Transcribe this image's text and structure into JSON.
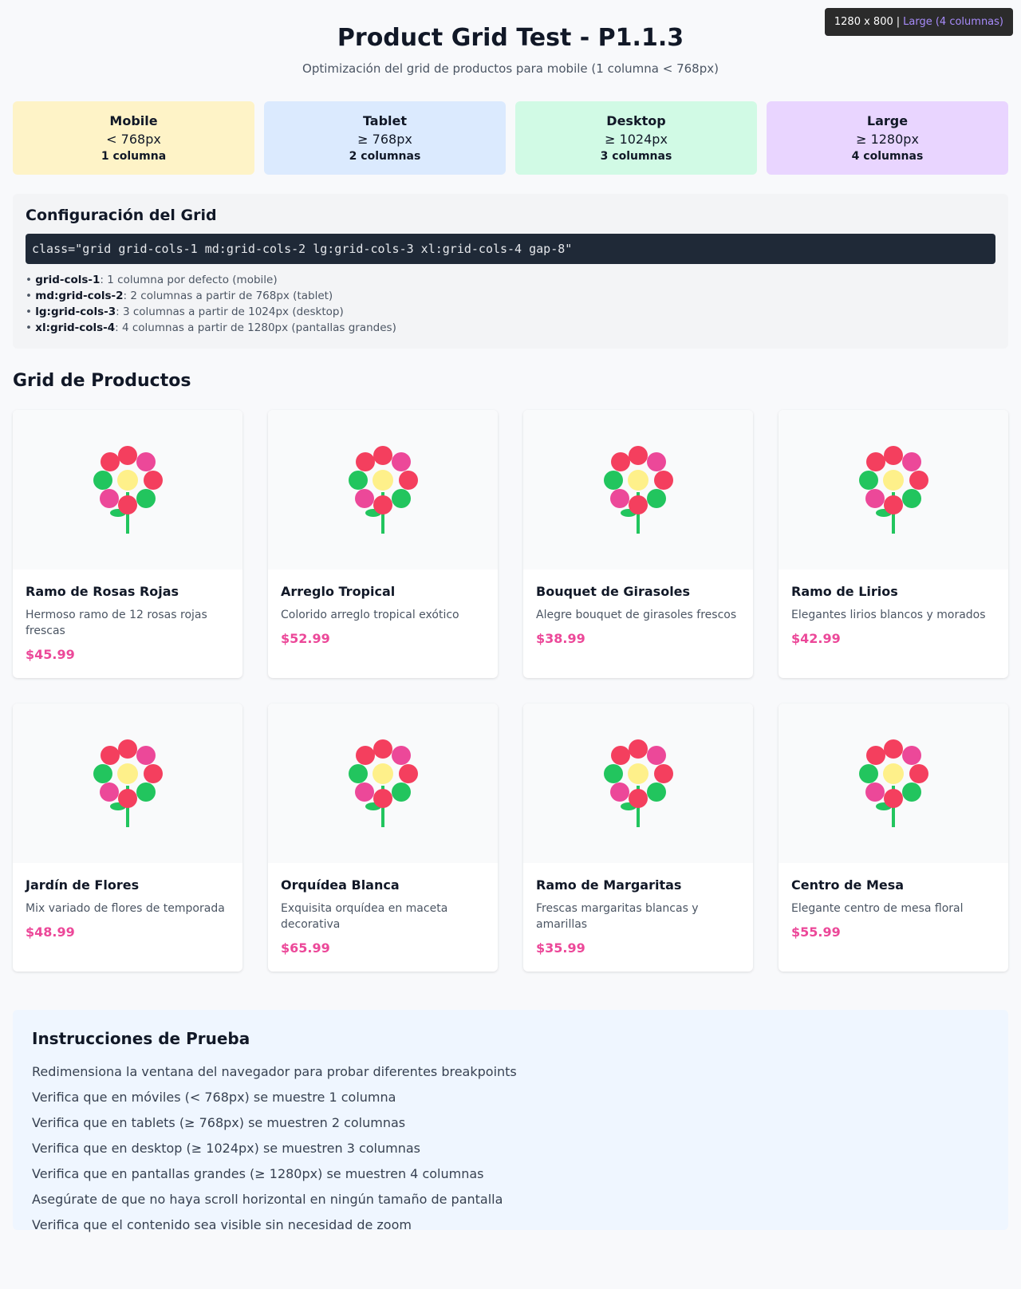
{
  "viewport": {
    "size": "1280 x 800",
    "separator": "|",
    "breakpoint": "Large (4 columnas)"
  },
  "header": {
    "title": "Product Grid Test - P1.1.3",
    "subtitle": "Optimización del grid de productos para mobile (1 columna < 768px)"
  },
  "breakpoints": [
    {
      "name": "Mobile",
      "size": "< 768px",
      "columns": "1 columna",
      "color": "#fef3c7"
    },
    {
      "name": "Tablet",
      "size": "≥ 768px",
      "columns": "2 columnas",
      "color": "#dbeafe"
    },
    {
      "name": "Desktop",
      "size": "≥ 1024px",
      "columns": "3 columnas",
      "color": "#d1fae5"
    },
    {
      "name": "Large",
      "size": "≥ 1280px",
      "columns": "4 columnas",
      "color": "#e9d5ff"
    }
  ],
  "config": {
    "title": "Configuración del Grid",
    "code": "class=\"grid grid-cols-1 md:grid-cols-2 lg:grid-cols-3 xl:grid-cols-4 gap-8\"",
    "items": [
      {
        "cls": "grid-cols-1",
        "text": ": 1 columna por defecto (mobile)"
      },
      {
        "cls": "md:grid-cols-2",
        "text": ": 2 columnas a partir de 768px (tablet)"
      },
      {
        "cls": "lg:grid-cols-3",
        "text": ": 3 columnas a partir de 1024px (desktop)"
      },
      {
        "cls": "xl:grid-cols-4",
        "text": ": 4 columnas a partir de 1280px (pantallas grandes)"
      }
    ]
  },
  "products_title": "Grid de Productos",
  "products": [
    {
      "name": "Ramo de Rosas Rojas",
      "description": "Hermoso ramo de 12 rosas rojas frescas",
      "price": "$45.99",
      "icon": "flower-icon"
    },
    {
      "name": "Arreglo Tropical",
      "description": "Colorido arreglo tropical exótico",
      "price": "$52.99",
      "icon": "flower-icon"
    },
    {
      "name": "Bouquet de Girasoles",
      "description": "Alegre bouquet de girasoles frescos",
      "price": "$38.99",
      "icon": "flower-icon"
    },
    {
      "name": "Ramo de Lirios",
      "description": "Elegantes lirios blancos y morados",
      "price": "$42.99",
      "icon": "flower-icon"
    },
    {
      "name": "Jardín de Flores",
      "description": "Mix variado de flores de temporada",
      "price": "$48.99",
      "icon": "flower-icon"
    },
    {
      "name": "Orquídea Blanca",
      "description": "Exquisita orquídea en maceta decorativa",
      "price": "$65.99",
      "icon": "flower-icon"
    },
    {
      "name": "Ramo de Margaritas",
      "description": "Frescas margaritas blancas y amarillas",
      "price": "$35.99",
      "icon": "flower-icon"
    },
    {
      "name": "Centro de Mesa",
      "description": "Elegante centro de mesa floral",
      "price": "$55.99",
      "icon": "flower-icon"
    }
  ],
  "instructions": {
    "title": "Instrucciones de Prueba",
    "items": [
      "Redimensiona la ventana del navegador para probar diferentes breakpoints",
      "Verifica que en móviles (< 768px) se muestre 1 columna",
      "Verifica que en tablets (≥ 768px) se muestren 2 columnas",
      "Verifica que en desktop (≥ 1024px) se muestren 3 columnas",
      "Verifica que en pantallas grandes (≥ 1280px) se muestren 4 columnas",
      "Asegúrate de que no haya scroll horizontal en ningún tamaño de pantalla",
      "Verifica que el contenido sea visible sin necesidad de zoom"
    ]
  },
  "colors": {
    "price": "#ec4899",
    "petal_red": "#f43f5e",
    "petal_pink": "#ec4899",
    "petal_green": "#22c55e",
    "center": "#fef08a",
    "stem": "#22c55e"
  }
}
